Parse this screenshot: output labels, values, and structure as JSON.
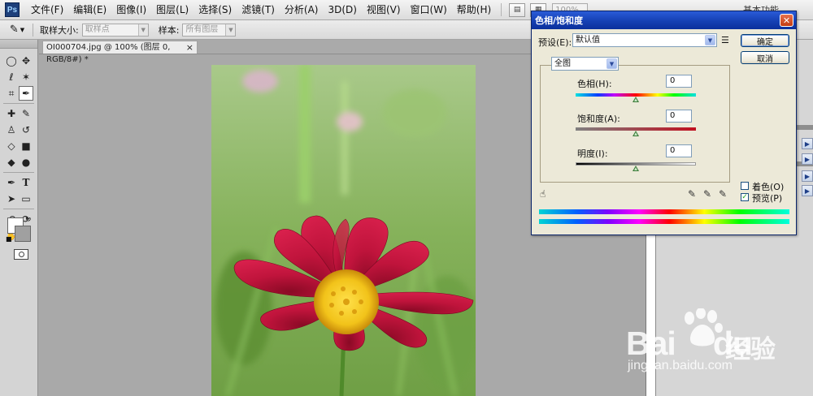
{
  "menubar": {
    "logo": "Ps",
    "items": [
      "文件(F)",
      "编辑(E)",
      "图像(I)",
      "图层(L)",
      "选择(S)",
      "滤镜(T)",
      "分析(A)",
      "3D(D)",
      "视图(V)",
      "窗口(W)",
      "帮助(H)"
    ],
    "zoom": "100%",
    "workspace": "基本功能"
  },
  "options": {
    "sample_size_label": "取样大小:",
    "sample_size_value": "取样点",
    "sample_label": "样本:",
    "sample_value": "所有图层"
  },
  "document": {
    "tab_title": "OI000704.jpg @ 100% (图层 0, RGB/8#) *",
    "close": "×"
  },
  "dialog": {
    "title": "色相/饱和度",
    "close": "✕",
    "preset_label": "预设(E):",
    "preset_value": "默认值",
    "ok": "确定",
    "cancel": "取消",
    "channel": "全图",
    "hue_label": "色相(H):",
    "hue_value": "0",
    "saturation_label": "饱和度(A):",
    "saturation_value": "0",
    "lightness_label": "明度(I):",
    "lightness_value": "0",
    "colorize_label": "着色(O)",
    "colorize_checked": false,
    "preview_label": "预览(P)",
    "preview_checked": true,
    "preview_check_mark": "✓"
  },
  "watermark": {
    "brand": "Bai",
    "brand_suffix": "du",
    "cn": "经验",
    "url": "jingyan.baidu.com"
  },
  "colors": {
    "dialog_title_bar": "#1540b3",
    "flower": "#c0143c",
    "flower_center": "#f2c31a",
    "photo_background": "#86b25b"
  }
}
